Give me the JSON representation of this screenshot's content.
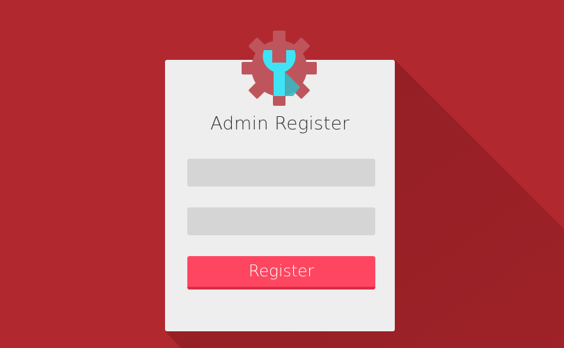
{
  "colors": {
    "background": "#b1292f",
    "shadow": "#8e1d22",
    "card": "#eeeeee",
    "input": "#d5d5d5",
    "button": "#fe4661",
    "button_border": "#d62f48",
    "title_text": "#333333",
    "gear": "#bf555c",
    "wrench": "#3ee4f5",
    "wrench_shadow": "#37b8c3"
  },
  "icons": {
    "logo": "gear-wrench-icon"
  },
  "form": {
    "title": "Admin Register",
    "username_placeholder": "",
    "password_placeholder": "",
    "submit_label": "Register"
  }
}
